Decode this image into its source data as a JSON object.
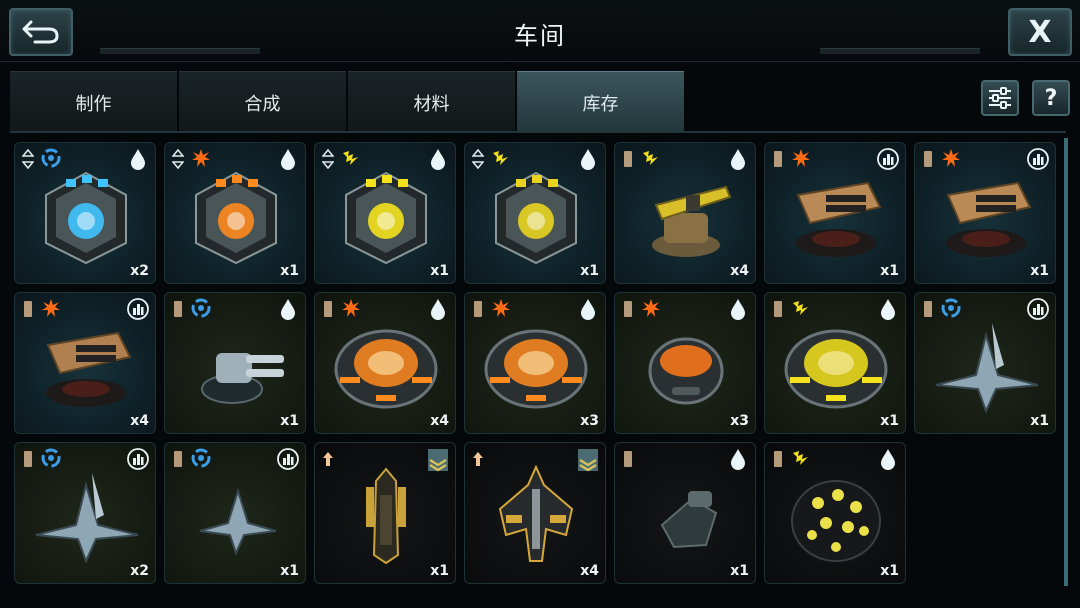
{
  "header": {
    "title": "车间",
    "close_label": "X"
  },
  "tabs": [
    {
      "label": "制作",
      "active": false
    },
    {
      "label": "合成",
      "active": false
    },
    {
      "label": "材料",
      "active": false
    },
    {
      "label": "库存",
      "active": true
    }
  ],
  "tools": {
    "help_label": "?"
  },
  "colors": {
    "tab_active": "#2e474d",
    "accent_border": "#47686f",
    "fire": "#ff6a14",
    "lightning": "#f2df1a",
    "swirl": "#3b9ee8"
  },
  "items": [
    {
      "name": "blue-core-module",
      "count": "x2",
      "bg": "blue",
      "marker": "sort-arrows-icon",
      "element": "swirl-icon",
      "badge": "drop-icon",
      "art": "box",
      "tone": "#3fc4ff"
    },
    {
      "name": "orange-core-module",
      "count": "x1",
      "bg": "blue",
      "marker": "sort-arrows-icon",
      "element": "fire-icon",
      "badge": "drop-icon",
      "art": "box",
      "tone": "#ff8a1e"
    },
    {
      "name": "yellow-core-module",
      "count": "x1",
      "bg": "blue",
      "marker": "sort-arrows-icon",
      "element": "lightning-icon",
      "badge": "drop-icon",
      "art": "box",
      "tone": "#f4e21c"
    },
    {
      "name": "yellow-core-module-2",
      "count": "x1",
      "bg": "blue",
      "marker": "sort-arrows-icon",
      "element": "lightning-icon",
      "badge": "drop-icon",
      "art": "box",
      "tone": "#e8d420"
    },
    {
      "name": "yellow-cannon-turret",
      "count": "x4",
      "bg": "blue",
      "marker": "grade-bar-icon",
      "element": "lightning-icon",
      "badge": "drop-icon",
      "art": "cannon",
      "tone": "#d9c02a"
    },
    {
      "name": "bronze-launcher-turret",
      "count": "x1",
      "bg": "blue",
      "marker": "grade-bar-icon",
      "element": "fire-icon",
      "badge": "city-icon",
      "art": "launcher",
      "tone": "#b98a55"
    },
    {
      "name": "bronze-launcher-turret-2",
      "count": "x1",
      "bg": "blue",
      "marker": "grade-bar-icon",
      "element": "fire-icon",
      "badge": "city-icon",
      "art": "launcher",
      "tone": "#b98a55"
    },
    {
      "name": "bronze-launcher-turret-3",
      "count": "x4",
      "bg": "blue",
      "marker": "grade-bar-icon",
      "element": "fire-icon",
      "badge": "city-icon",
      "art": "launcher",
      "tone": "#b08050"
    },
    {
      "name": "grey-twin-turret",
      "count": "x1",
      "bg": "olive",
      "marker": "grade-bar-icon",
      "element": "swirl-icon",
      "badge": "drop-icon",
      "art": "twin",
      "tone": "#9fb0b8"
    },
    {
      "name": "orange-reactor-large",
      "count": "x4",
      "bg": "olive",
      "marker": "grade-bar-icon",
      "element": "fire-icon",
      "badge": "drop-icon",
      "art": "reactor",
      "tone": "#ff8a1e"
    },
    {
      "name": "orange-reactor-medium",
      "count": "x3",
      "bg": "olive",
      "marker": "grade-bar-icon",
      "element": "fire-icon",
      "badge": "drop-icon",
      "art": "reactor",
      "tone": "#ff8a1e"
    },
    {
      "name": "orange-reactor-small",
      "count": "x3",
      "bg": "olive",
      "marker": "grade-bar-icon",
      "element": "fire-icon",
      "badge": "drop-icon",
      "art": "reactor-small",
      "tone": "#ff7a1a"
    },
    {
      "name": "yellow-reactor",
      "count": "x1",
      "bg": "olive",
      "marker": "grade-bar-icon",
      "element": "lightning-icon",
      "badge": "drop-icon",
      "art": "reactor",
      "tone": "#f4e21c"
    },
    {
      "name": "blue-wing-fighter",
      "count": "x1",
      "bg": "olive",
      "marker": "grade-bar-icon",
      "element": "swirl-icon",
      "badge": "city-icon",
      "art": "wing",
      "tone": "#8fa6b4"
    },
    {
      "name": "blue-wing-fighter-2",
      "count": "x2",
      "bg": "olive",
      "marker": "grade-bar-icon",
      "element": "swirl-icon",
      "badge": "city-icon",
      "art": "wing",
      "tone": "#8fa6b4"
    },
    {
      "name": "blue-wing-fighter-3",
      "count": "x1",
      "bg": "olive",
      "marker": "grade-bar-icon",
      "element": "swirl-icon",
      "badge": "city-icon",
      "art": "wing-small",
      "tone": "#8fa6b4"
    },
    {
      "name": "gold-cruiser-ship",
      "count": "x1",
      "bg": "dark",
      "marker": "up-arrow-icon",
      "element": "",
      "badge": "rank-chevron-icon",
      "art": "ship",
      "tone": "#c9a23a"
    },
    {
      "name": "gold-battleship",
      "count": "x4",
      "bg": "dark",
      "marker": "up-arrow-icon",
      "element": "",
      "badge": "rank-chevron-icon",
      "art": "ship-big",
      "tone": "#d6a83a"
    },
    {
      "name": "dark-gun-module",
      "count": "x1",
      "bg": "dark",
      "marker": "grade-bar-icon",
      "element": "",
      "badge": "drop-icon",
      "art": "gun",
      "tone": "#5b6a6c"
    },
    {
      "name": "yellow-lattice-orb",
      "count": "x1",
      "bg": "dark",
      "marker": "grade-bar-icon",
      "element": "lightning-icon",
      "badge": "drop-icon",
      "art": "orb",
      "tone": "#e9e04a"
    }
  ]
}
